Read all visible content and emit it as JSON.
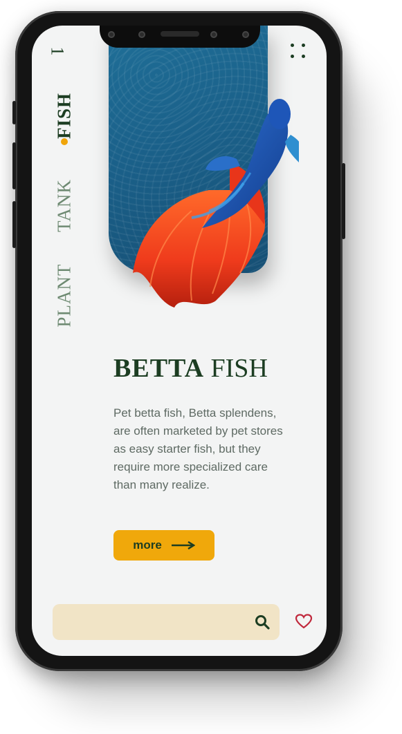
{
  "header": {
    "page_number": "1"
  },
  "nav": {
    "items": [
      {
        "label": "FISH",
        "active": true
      },
      {
        "label": "TANK",
        "active": false
      },
      {
        "label": "PLANT",
        "active": false
      }
    ]
  },
  "product": {
    "title_bold": "BETTA",
    "title_regular": " FISH",
    "description": "Pet betta fish, Betta splendens, are often marketed by pet stores as easy starter fish, but they require more specialized care than many realize.",
    "more_label": "more"
  },
  "search": {
    "placeholder": "",
    "value": ""
  },
  "icons": {
    "menu": "grid-dots-icon",
    "search": "search-icon",
    "favorite": "heart-icon",
    "arrow": "arrow-right-icon"
  },
  "colors": {
    "primary": "#1c3d22",
    "accent": "#f0a80b",
    "search_bg": "#f1e4c6",
    "heart": "#c0283c",
    "card": "#1a5f88"
  }
}
